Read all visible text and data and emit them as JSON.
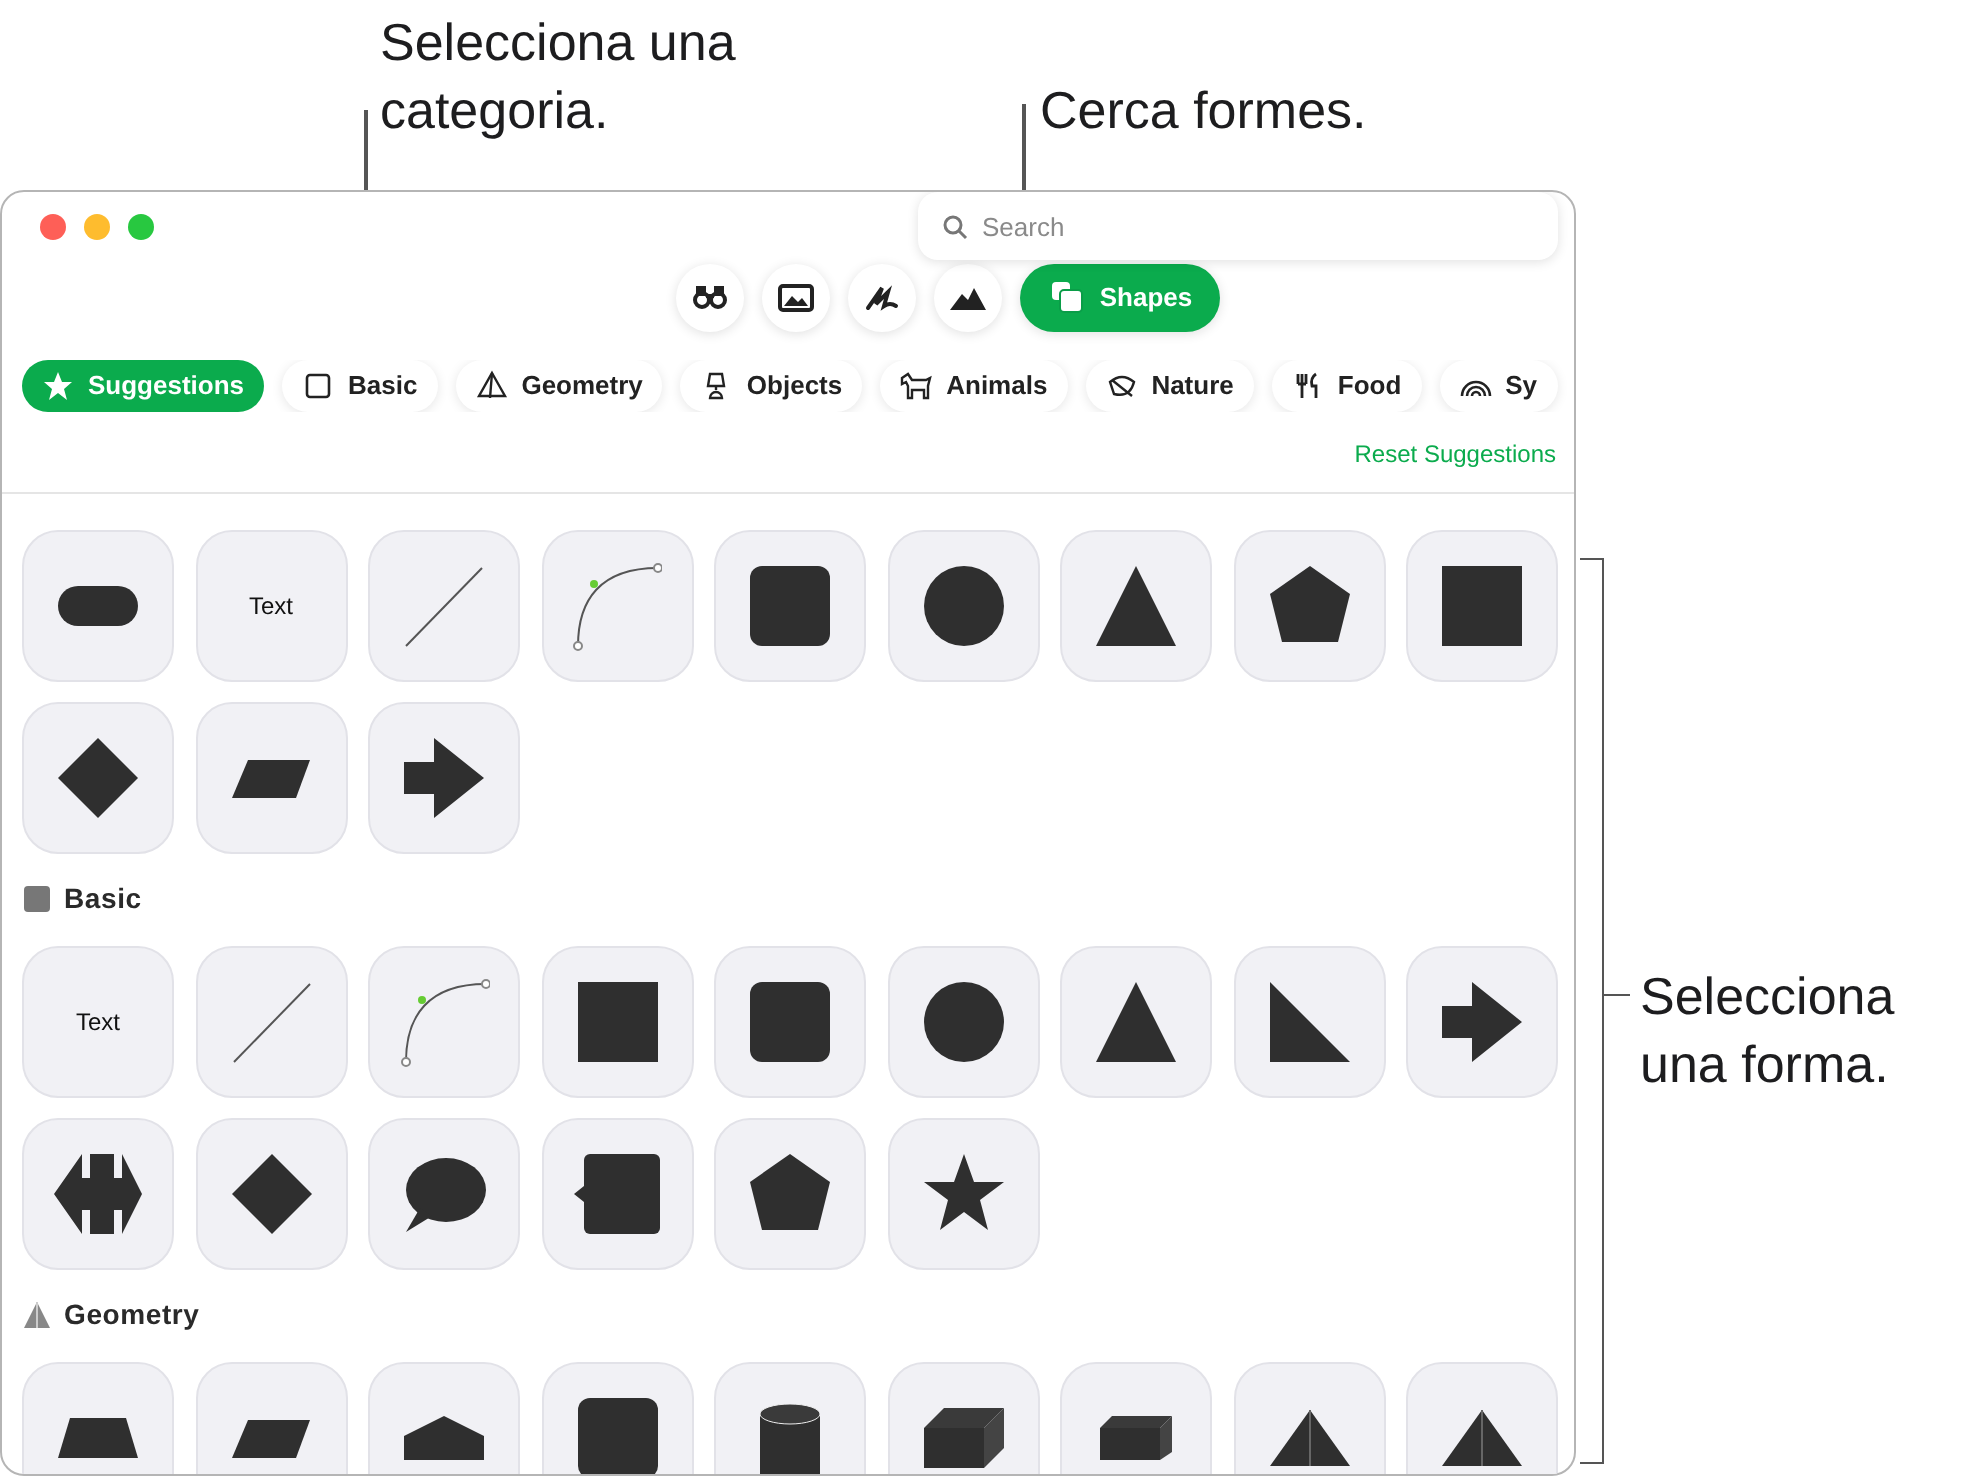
{
  "callouts": [
    {
      "text": "Selecciona una categoria."
    },
    {
      "text": "Cerca formes."
    },
    {
      "text": "Selecciona una forma."
    }
  ],
  "search": {
    "placeholder": "Search"
  },
  "toolbar": [
    {
      "selected": false
    },
    {
      "selected": false
    },
    {
      "selected": false
    },
    {
      "selected": false
    },
    {
      "label": "Shapes",
      "selected": true
    }
  ],
  "categories": [
    {
      "label": "Suggestions",
      "selected": true
    },
    {
      "label": "Basic",
      "selected": false
    },
    {
      "label": "Geometry",
      "selected": false
    },
    {
      "label": "Objects",
      "selected": false
    },
    {
      "label": "Animals",
      "selected": false
    },
    {
      "label": "Nature",
      "selected": false
    },
    {
      "label": "Food",
      "selected": false
    },
    {
      "label": "Sy",
      "selected": false
    }
  ],
  "reset_link": "Reset Suggestions",
  "sections": [
    {
      "tiles": [
        {
          "kind": "pill"
        },
        {
          "kind": "text",
          "text": "Text"
        },
        {
          "kind": "line"
        },
        {
          "kind": "curve"
        },
        {
          "kind": "roundsquare"
        },
        {
          "kind": "circle"
        },
        {
          "kind": "triangle"
        },
        {
          "kind": "pentagon"
        },
        {
          "kind": "square"
        },
        {
          "kind": "diamond"
        },
        {
          "kind": "parallelogram"
        },
        {
          "kind": "arrow"
        }
      ]
    },
    {
      "title": "Basic",
      "tiles": [
        {
          "kind": "text",
          "text": "Text"
        },
        {
          "kind": "line"
        },
        {
          "kind": "curve"
        },
        {
          "kind": "square"
        },
        {
          "kind": "roundsquare"
        },
        {
          "kind": "circle"
        },
        {
          "kind": "triangle"
        },
        {
          "kind": "righttriangle"
        },
        {
          "kind": "arrow"
        },
        {
          "kind": "doublearrow"
        },
        {
          "kind": "diamond"
        },
        {
          "kind": "speech"
        },
        {
          "kind": "callout"
        },
        {
          "kind": "pentagon"
        },
        {
          "kind": "star"
        }
      ]
    },
    {
      "title": "Geometry",
      "tiles": [
        {
          "kind": "trapezoid"
        },
        {
          "kind": "parallelogram"
        },
        {
          "kind": "house"
        },
        {
          "kind": "roundsquare"
        },
        {
          "kind": "cylinder"
        },
        {
          "kind": "cube"
        },
        {
          "kind": "box"
        },
        {
          "kind": "pyramid"
        },
        {
          "kind": "pyramid"
        }
      ]
    }
  ]
}
